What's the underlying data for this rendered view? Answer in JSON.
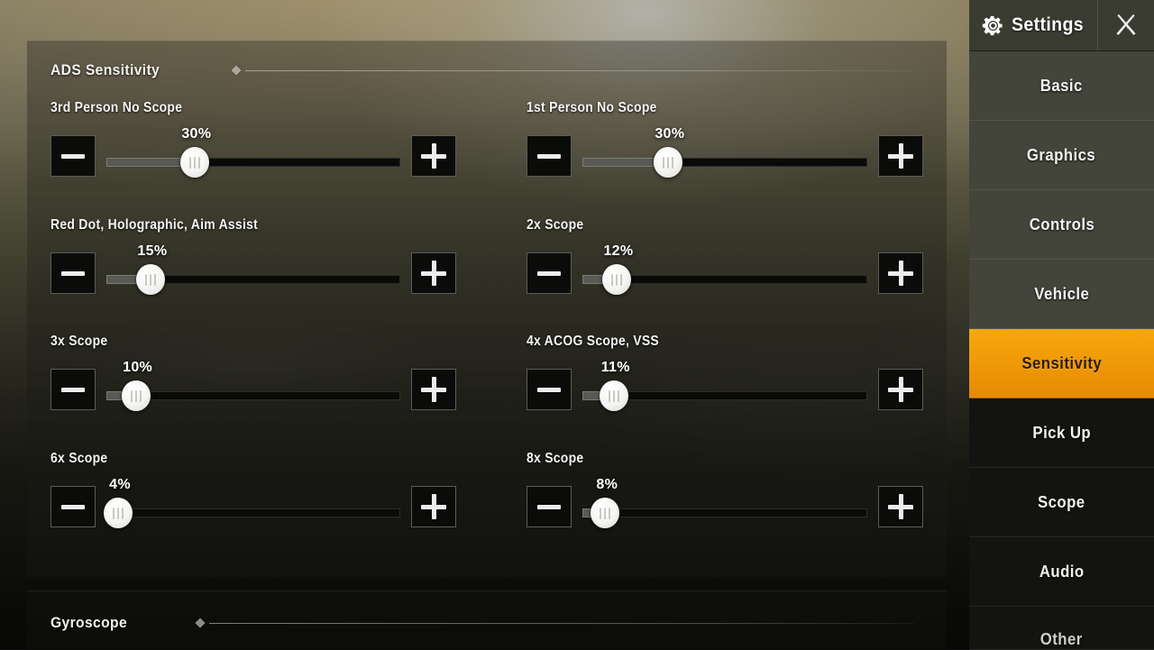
{
  "sidebar": {
    "title": "Settings",
    "gear_icon": "gear-icon",
    "close_icon": "close-x-icon",
    "items": [
      {
        "label": "Basic",
        "active": false
      },
      {
        "label": "Graphics",
        "active": false
      },
      {
        "label": "Controls",
        "active": false
      },
      {
        "label": "Vehicle",
        "active": false
      },
      {
        "label": "Sensitivity",
        "active": true
      },
      {
        "label": "Pick Up",
        "active": false
      },
      {
        "label": "Scope",
        "active": false
      },
      {
        "label": "Audio",
        "active": false
      },
      {
        "label": "Other",
        "active": false
      }
    ]
  },
  "main": {
    "sections": [
      {
        "title": "ADS Sensitivity"
      },
      {
        "title": "Gyroscope"
      }
    ],
    "controls": {
      "minus_label": "−",
      "plus_label": "+"
    },
    "sliders": [
      {
        "label": "3rd Person No Scope",
        "value": "30%",
        "percent": 30,
        "col": 0,
        "row": 0
      },
      {
        "label": "1st Person No Scope",
        "value": "30%",
        "percent": 30,
        "col": 1,
        "row": 0
      },
      {
        "label": "Red Dot, Holographic, Aim Assist",
        "value": "15%",
        "percent": 15,
        "col": 0,
        "row": 1
      },
      {
        "label": "2x Scope",
        "value": "12%",
        "percent": 12,
        "col": 1,
        "row": 1
      },
      {
        "label": "3x Scope",
        "value": "10%",
        "percent": 10,
        "col": 0,
        "row": 2
      },
      {
        "label": "4x ACOG Scope, VSS",
        "value": "11%",
        "percent": 11,
        "col": 1,
        "row": 2
      },
      {
        "label": "6x Scope",
        "value": "4%",
        "percent": 4,
        "col": 0,
        "row": 3
      },
      {
        "label": "8x Scope",
        "value": "8%",
        "percent": 8,
        "col": 1,
        "row": 3
      }
    ]
  },
  "colors": {
    "accent": "#f09a08",
    "panel": "#1a1a16",
    "sidebar_header": "#3a3c32",
    "text": "#f4f4f1"
  }
}
